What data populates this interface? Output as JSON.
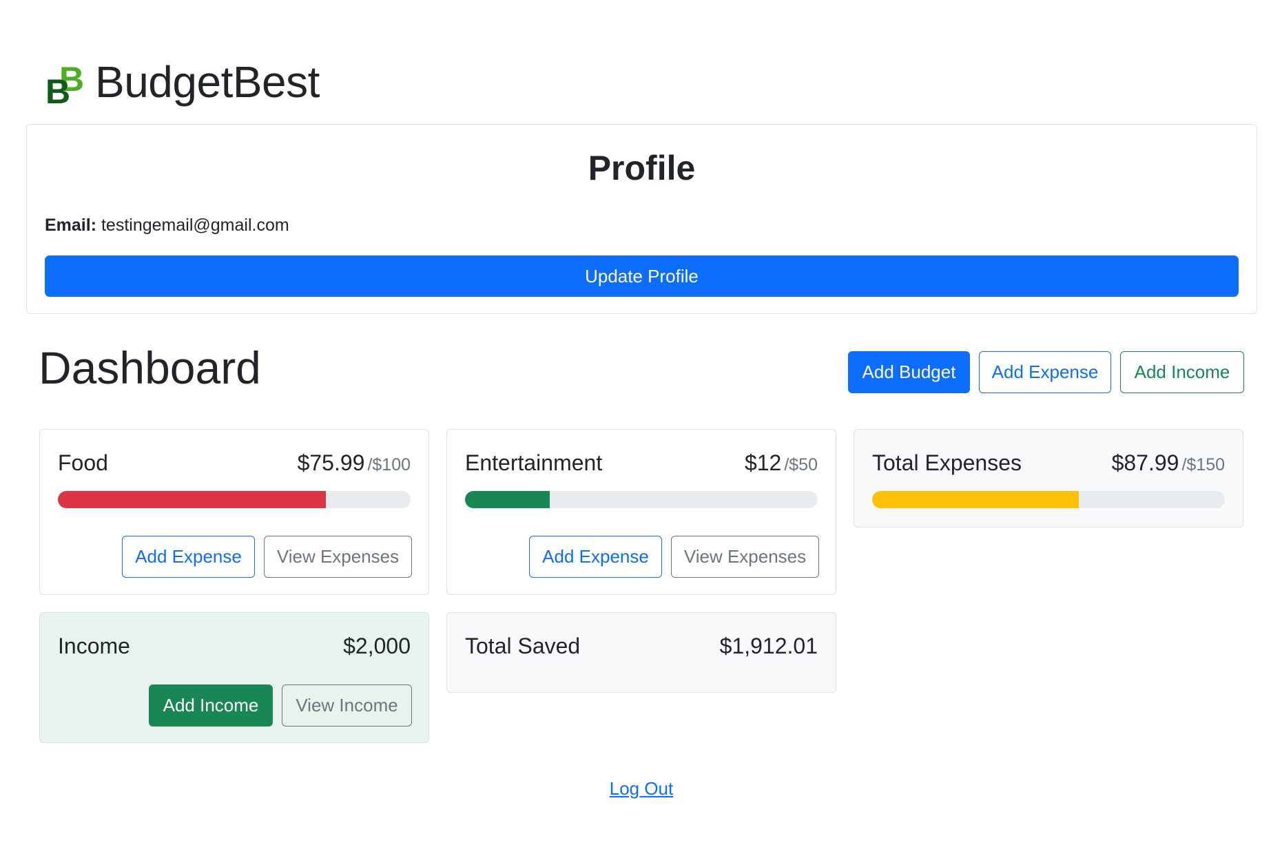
{
  "brand": {
    "name": "BudgetBest"
  },
  "profile": {
    "title": "Profile",
    "email_label": "Email:",
    "email_value": "testingemail@gmail.com",
    "update_button": "Update Profile"
  },
  "dashboard": {
    "title": "Dashboard",
    "actions": {
      "add_budget": "Add Budget",
      "add_expense": "Add Expense",
      "add_income": "Add Income"
    }
  },
  "budgets": [
    {
      "name": "Food",
      "amount": "$75.99",
      "max": "/$100",
      "progress": 0.76,
      "color": "#dc3545",
      "add_label": "Add Expense",
      "view_label": "View Expenses"
    },
    {
      "name": "Entertainment",
      "amount": "$12",
      "max": "/$50",
      "progress": 0.24,
      "color": "#198754",
      "add_label": "Add Expense",
      "view_label": "View Expenses"
    }
  ],
  "totals": {
    "expenses": {
      "name": "Total Expenses",
      "amount": "$87.99",
      "max": "/$150",
      "progress": 0.5866,
      "color": "#ffc107"
    },
    "income": {
      "name": "Income",
      "amount": "$2,000",
      "add_label": "Add Income",
      "view_label": "View Income"
    },
    "saved": {
      "name": "Total Saved",
      "amount": "$1,912.01"
    }
  },
  "logout": "Log Out",
  "colors": {
    "primary": "#0d6efd",
    "success": "#198754",
    "danger": "#dc3545",
    "warning": "#ffc107",
    "secondary": "#6c757d"
  }
}
